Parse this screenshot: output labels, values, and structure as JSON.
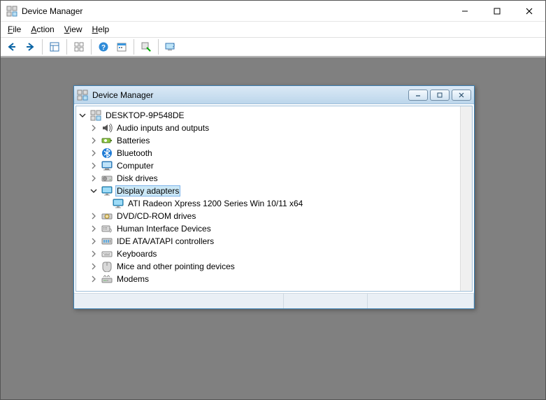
{
  "outer": {
    "title": "Device Manager",
    "menus": [
      "File",
      "Action",
      "View",
      "Help"
    ]
  },
  "inner": {
    "title": "Device Manager"
  },
  "tree": {
    "root": "DESKTOP-9P548DE",
    "nodes": [
      {
        "label": "Audio inputs and outputs",
        "icon": "audio"
      },
      {
        "label": "Batteries",
        "icon": "battery"
      },
      {
        "label": "Bluetooth",
        "icon": "bluetooth"
      },
      {
        "label": "Computer",
        "icon": "computer"
      },
      {
        "label": "Disk drives",
        "icon": "disk"
      },
      {
        "label": "Display adapters",
        "icon": "display",
        "expanded": true,
        "selected": true,
        "children": [
          {
            "label": "ATI Radeon Xpress 1200 Series Win 10/11 x64",
            "icon": "display"
          }
        ]
      },
      {
        "label": "DVD/CD-ROM drives",
        "icon": "dvd"
      },
      {
        "label": "Human Interface Devices",
        "icon": "hid"
      },
      {
        "label": "IDE ATA/ATAPI controllers",
        "icon": "ide"
      },
      {
        "label": "Keyboards",
        "icon": "keyboard"
      },
      {
        "label": "Mice and other pointing devices",
        "icon": "mouse"
      },
      {
        "label": "Modems",
        "icon": "modem"
      }
    ]
  }
}
